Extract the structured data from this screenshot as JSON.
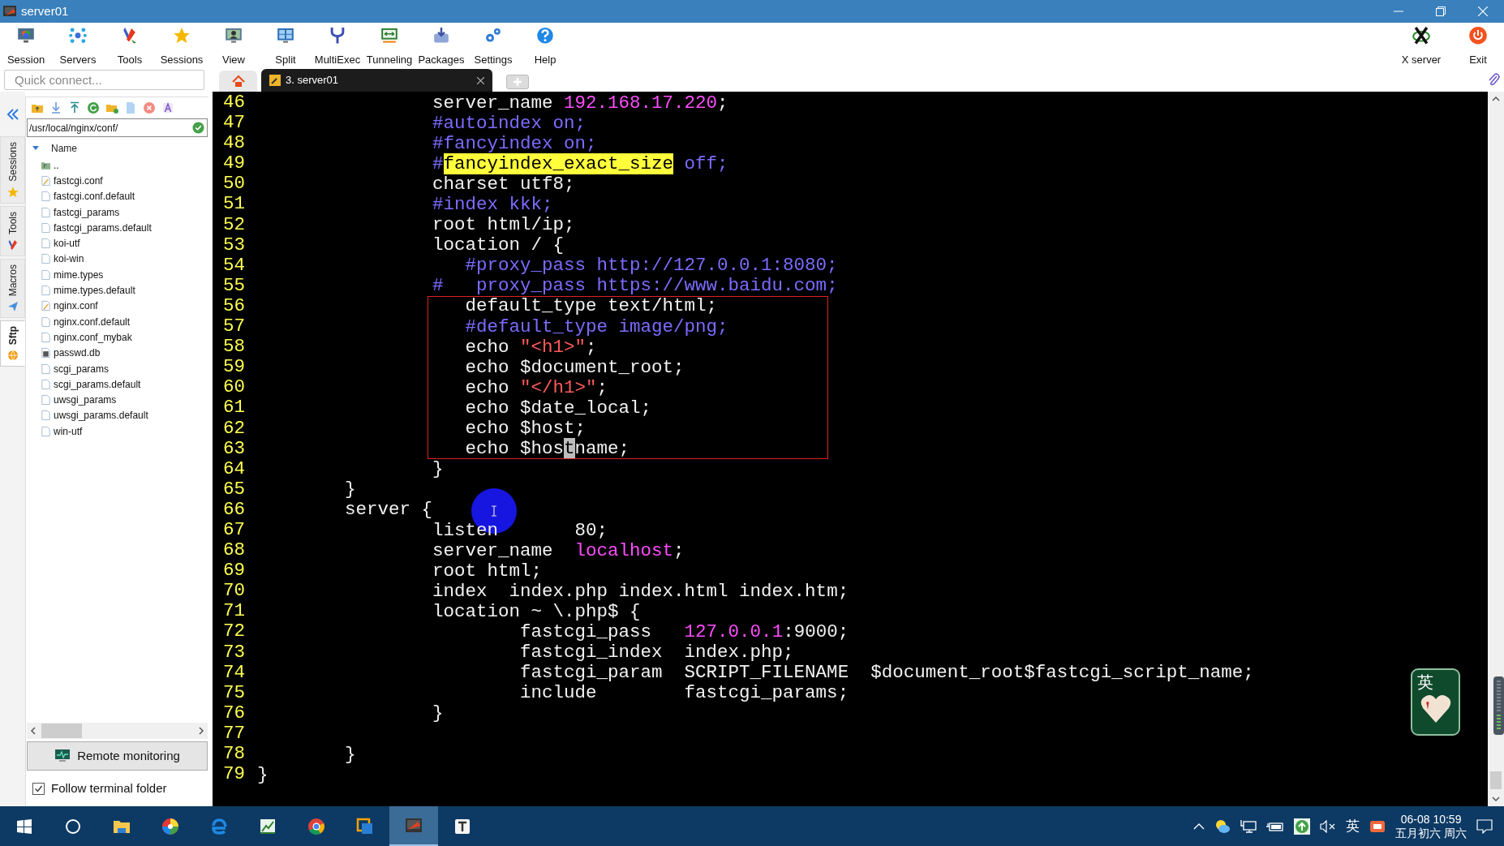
{
  "window": {
    "title": "server01"
  },
  "toolbar": [
    {
      "label": "Session"
    },
    {
      "label": "Servers"
    },
    {
      "label": "Tools"
    },
    {
      "label": "Sessions"
    },
    {
      "label": "View"
    },
    {
      "label": "Split"
    },
    {
      "label": "MultiExec"
    },
    {
      "label": "Tunneling"
    },
    {
      "label": "Packages"
    },
    {
      "label": "Settings"
    },
    {
      "label": "Help"
    }
  ],
  "toolbar_right": [
    {
      "label": "X server"
    },
    {
      "label": "Exit"
    }
  ],
  "quick_connect": {
    "placeholder": "Quick connect..."
  },
  "tabs": [
    {
      "kind": "home",
      "selected": false
    },
    {
      "kind": "session",
      "label": "3. server01",
      "selected": true
    }
  ],
  "side_tabs": [
    {
      "label": "Sessions",
      "selected": false
    },
    {
      "label": "Tools",
      "selected": false
    },
    {
      "label": "Macros",
      "selected": false
    },
    {
      "label": "Sftp",
      "selected": true
    }
  ],
  "sftp": {
    "path": "/usr/local/nginx/conf/",
    "column": "Name",
    "files": [
      {
        "name": "..",
        "kind": "parent"
      },
      {
        "name": "fastcgi.conf",
        "kind": "edited"
      },
      {
        "name": "fastcgi.conf.default",
        "kind": "file"
      },
      {
        "name": "fastcgi_params",
        "kind": "file"
      },
      {
        "name": "fastcgi_params.default",
        "kind": "file"
      },
      {
        "name": "koi-utf",
        "kind": "file"
      },
      {
        "name": "koi-win",
        "kind": "file"
      },
      {
        "name": "mime.types",
        "kind": "file"
      },
      {
        "name": "mime.types.default",
        "kind": "file"
      },
      {
        "name": "nginx.conf",
        "kind": "edited"
      },
      {
        "name": "nginx.conf.default",
        "kind": "file"
      },
      {
        "name": "nginx.conf_mybak",
        "kind": "file"
      },
      {
        "name": "passwd.db",
        "kind": "db"
      },
      {
        "name": "scgi_params",
        "kind": "file"
      },
      {
        "name": "scgi_params.default",
        "kind": "file"
      },
      {
        "name": "uwsgi_params",
        "kind": "file"
      },
      {
        "name": "uwsgi_params.default",
        "kind": "file"
      },
      {
        "name": "win-utf",
        "kind": "file"
      }
    ],
    "remote_monitoring": "Remote monitoring",
    "follow_terminal_folder": {
      "label": "Follow terminal folder",
      "checked": true
    }
  },
  "terminal": {
    "lines": [
      {
        "kind": "line",
        "number": "46",
        "segments": [
          {
            "kind": "plain",
            "text": "                server_name "
          },
          {
            "kind": "literal",
            "text": "192.168.17.220"
          },
          {
            "kind": "plain",
            "text": ";"
          }
        ]
      },
      {
        "kind": "line",
        "number": "47",
        "segments": [
          {
            "kind": "comment",
            "text": "                #autoindex on;"
          }
        ]
      },
      {
        "kind": "line",
        "number": "48",
        "segments": [
          {
            "kind": "comment",
            "text": "                #fancyindex on;"
          }
        ]
      },
      {
        "kind": "line",
        "number": "49",
        "segments": [
          {
            "kind": "comment",
            "text": "                #"
          },
          {
            "kind": "highlight",
            "text": "fancyindex_exact_size"
          },
          {
            "kind": "comment",
            "text": " off;"
          }
        ]
      },
      {
        "kind": "line",
        "number": "50",
        "segments": [
          {
            "kind": "plain",
            "text": "                charset utf8;"
          }
        ]
      },
      {
        "kind": "line",
        "number": "51",
        "segments": [
          {
            "kind": "comment",
            "text": "                #index kkk;"
          }
        ]
      },
      {
        "kind": "line",
        "number": "52",
        "segments": [
          {
            "kind": "plain",
            "text": "                root html/ip;"
          }
        ]
      },
      {
        "kind": "line",
        "number": "53",
        "segments": [
          {
            "kind": "plain",
            "text": "                location / {"
          }
        ]
      },
      {
        "kind": "line",
        "number": "54",
        "segments": [
          {
            "kind": "comment",
            "text": "                   #proxy_pass http://127.0.0.1:8080;"
          }
        ]
      },
      {
        "kind": "line",
        "number": "55",
        "segments": [
          {
            "kind": "comment",
            "text": "                #   proxy_pass https://www.baidu.com;"
          }
        ]
      },
      {
        "kind": "box",
        "children": [
          {
            "kind": "line",
            "number": "56",
            "segments": [
              {
                "kind": "plain",
                "text": "                   default_type text/html;"
              }
            ]
          },
          {
            "kind": "line",
            "number": "57",
            "segments": [
              {
                "kind": "comment",
                "text": "                   #default_type image/png;"
              }
            ]
          },
          {
            "kind": "line",
            "number": "58",
            "segments": [
              {
                "kind": "plain",
                "text": "                   echo "
              },
              {
                "kind": "string",
                "text": "\"<h1>\""
              },
              {
                "kind": "plain",
                "text": ";"
              }
            ]
          },
          {
            "kind": "line",
            "number": "59",
            "segments": [
              {
                "kind": "plain",
                "text": "                   echo $document_root;"
              }
            ]
          },
          {
            "kind": "line",
            "number": "60",
            "segments": [
              {
                "kind": "plain",
                "text": "                   echo "
              },
              {
                "kind": "string",
                "text": "\"</h1>\""
              },
              {
                "kind": "plain",
                "text": ";"
              }
            ]
          },
          {
            "kind": "line",
            "number": "61",
            "segments": [
              {
                "kind": "plain",
                "text": "                   echo $date_local;"
              }
            ]
          },
          {
            "kind": "line",
            "number": "62",
            "segments": [
              {
                "kind": "plain",
                "text": "                   echo $host;"
              }
            ]
          },
          {
            "kind": "line",
            "number": "63",
            "segments": [
              {
                "kind": "plain",
                "text": "                   echo $hos"
              },
              {
                "kind": "cursor",
                "text": "t"
              },
              {
                "kind": "plain",
                "text": "name;"
              }
            ]
          }
        ]
      },
      {
        "kind": "line",
        "number": "64",
        "segments": [
          {
            "kind": "plain",
            "text": "                }"
          }
        ]
      },
      {
        "kind": "line",
        "number": "65",
        "segments": [
          {
            "kind": "plain",
            "text": "        }"
          }
        ]
      },
      {
        "kind": "line",
        "number": "66",
        "segments": [
          {
            "kind": "plain",
            "text": "        server {"
          }
        ]
      },
      {
        "kind": "line",
        "number": "67",
        "segments": [
          {
            "kind": "plain",
            "text": "                listen       80;"
          }
        ]
      },
      {
        "kind": "line",
        "number": "68",
        "segments": [
          {
            "kind": "plain",
            "text": "                server_name  "
          },
          {
            "kind": "literal",
            "text": "localhost"
          },
          {
            "kind": "plain",
            "text": ";"
          }
        ]
      },
      {
        "kind": "line",
        "number": "69",
        "segments": [
          {
            "kind": "plain",
            "text": "                root html;"
          }
        ]
      },
      {
        "kind": "line",
        "number": "70",
        "segments": [
          {
            "kind": "plain",
            "text": "                index  index.php index.html index.htm;"
          }
        ]
      },
      {
        "kind": "line",
        "number": "71",
        "segments": [
          {
            "kind": "plain",
            "text": "                location ~ \\.php$ {"
          }
        ]
      },
      {
        "kind": "line",
        "number": "72",
        "segments": [
          {
            "kind": "plain",
            "text": "                        fastcgi_pass   "
          },
          {
            "kind": "literal",
            "text": "127.0.0.1"
          },
          {
            "kind": "plain",
            "text": ":9000;"
          }
        ]
      },
      {
        "kind": "line",
        "number": "73",
        "segments": [
          {
            "kind": "plain",
            "text": "                        fastcgi_index  index.php;"
          }
        ]
      },
      {
        "kind": "line",
        "number": "74",
        "segments": [
          {
            "kind": "plain",
            "text": "                        fastcgi_param  SCRIPT_FILENAME  $document_root$fastcgi_script_name;"
          }
        ]
      },
      {
        "kind": "line",
        "number": "75",
        "segments": [
          {
            "kind": "plain",
            "text": "                        include        fastcgi_params;"
          }
        ]
      },
      {
        "kind": "line",
        "number": "76",
        "segments": [
          {
            "kind": "plain",
            "text": "                }"
          }
        ]
      },
      {
        "kind": "line",
        "number": "77"
      },
      {
        "kind": "line",
        "number": "78",
        "segments": [
          {
            "kind": "plain",
            "text": "        }"
          }
        ]
      },
      {
        "kind": "line",
        "number": "79",
        "segments": [
          {
            "kind": "plain",
            "text": "}"
          }
        ]
      }
    ]
  },
  "ime_widget": {
    "label": "英"
  },
  "taskbar": {
    "items": [
      {
        "selected": false
      },
      {
        "selected": false
      },
      {
        "selected": false
      },
      {
        "selected": false
      },
      {
        "selected": false
      },
      {
        "selected": false
      },
      {
        "selected": false
      },
      {
        "selected": false
      },
      {
        "selected": true
      },
      {
        "selected": false
      }
    ],
    "tray": {
      "ime": "英",
      "time": "06-08 10:59",
      "lunar_date": "五月初六 周六"
    }
  }
}
